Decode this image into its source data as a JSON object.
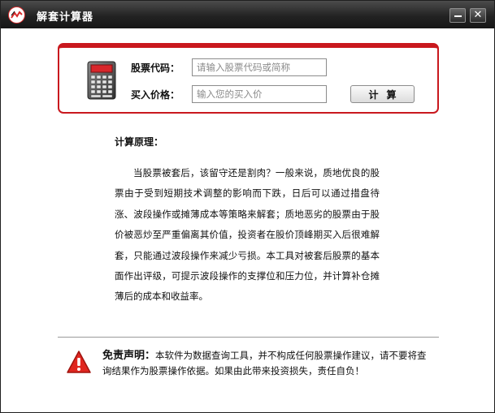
{
  "window": {
    "title": "解套计算器",
    "minimize_symbol": "",
    "close_symbol": "✕"
  },
  "form": {
    "code_label": "股票代码：",
    "code_placeholder": "请输入股票代码或简称",
    "code_value": "",
    "price_label": "买入价格：",
    "price_placeholder": "输入您的买入价",
    "price_value": "",
    "calc_button": "计算"
  },
  "principle": {
    "title": "计算原理：",
    "body": "当股票被套后，该留守还是割肉？一般来说，质地优良的股票由于受到短期技术调整的影响而下跌，日后可以通过措盘待涨、波段操作或摊薄成本等策略来解套；质地恶劣的股票由于股价被恶炒至严重偏离其价值，投资者在股价顶峰期买入后很难解套，只能通过波段操作来减少亏损。本工具对被套后股票的基本面作出评级，可提示波段操作的支撑位和压力位，并计算补仓摊薄后的成本和收益率。"
  },
  "disclaimer": {
    "title": "免责声明：",
    "body": "本软件为数据查询工具，并不构成任何股票操作建议，请不要将查询结果作为股票操作依据。如果由此带来投资损失，责任自负！"
  },
  "icons": {
    "app": "app-logo-icon",
    "calculator": "calculator-icon",
    "warning": "warning-icon"
  },
  "colors": {
    "accent_red": "#c9181e",
    "titlebar": "#232323"
  }
}
